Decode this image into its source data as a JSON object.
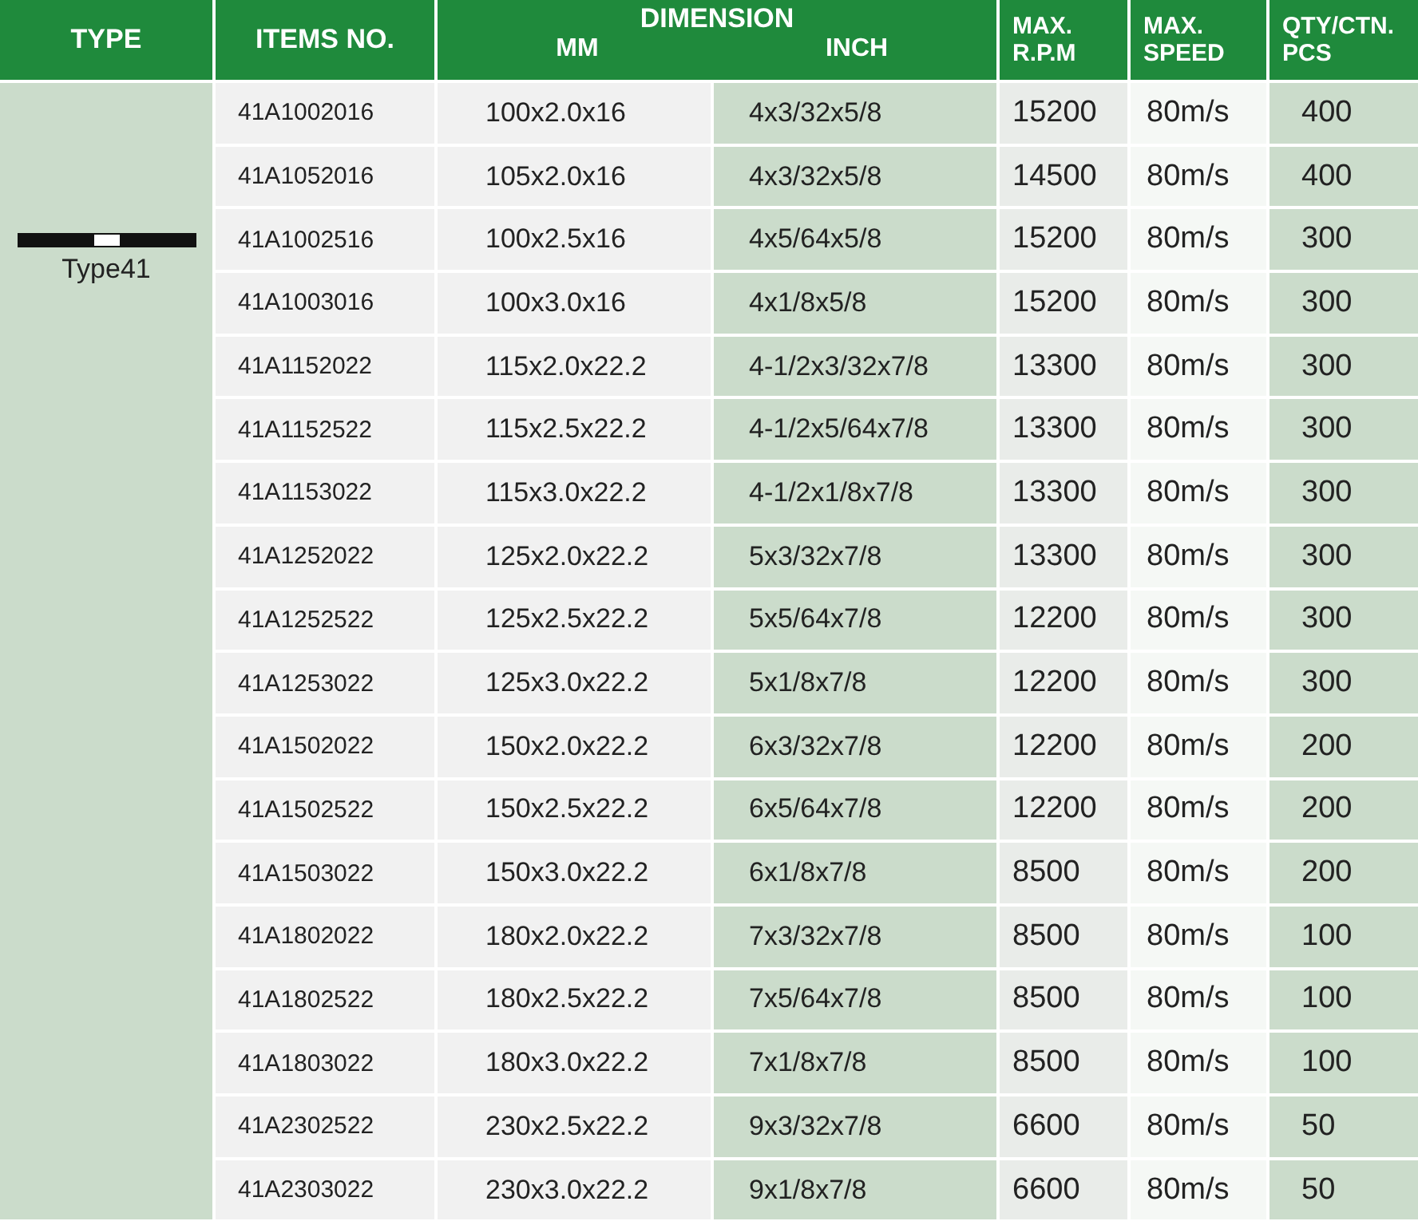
{
  "header": {
    "type": "TYPE",
    "items_no": "ITEMS NO.",
    "dimension": "DIMENSION",
    "mm": "MM",
    "inch": "INCH",
    "max_rpm": [
      "MAX.",
      "R.P.M"
    ],
    "max_speed": [
      "MAX.",
      "SPEED"
    ],
    "qty": [
      "QTY/CTN.",
      "PCS"
    ]
  },
  "type_cell": {
    "label": "Type41"
  },
  "rows": [
    {
      "item": "41A1002016",
      "mm": "100x2.0x16",
      "inch": "4x3/32x5/8",
      "rpm": "15200",
      "speed": "80m/s",
      "qty": "400"
    },
    {
      "item": "41A1052016",
      "mm": "105x2.0x16",
      "inch": "4x3/32x5/8",
      "rpm": "14500",
      "speed": "80m/s",
      "qty": "400"
    },
    {
      "item": "41A1002516",
      "mm": "100x2.5x16",
      "inch": "4x5/64x5/8",
      "rpm": "15200",
      "speed": "80m/s",
      "qty": "300"
    },
    {
      "item": "41A1003016",
      "mm": "100x3.0x16",
      "inch": "4x1/8x5/8",
      "rpm": "15200",
      "speed": "80m/s",
      "qty": "300"
    },
    {
      "item": "41A1152022",
      "mm": "115x2.0x22.2",
      "inch": "4-1/2x3/32x7/8",
      "rpm": "13300",
      "speed": "80m/s",
      "qty": "300"
    },
    {
      "item": "41A1152522",
      "mm": "115x2.5x22.2",
      "inch": "4-1/2x5/64x7/8",
      "rpm": "13300",
      "speed": "80m/s",
      "qty": "300"
    },
    {
      "item": "41A1153022",
      "mm": "115x3.0x22.2",
      "inch": "4-1/2x1/8x7/8",
      "rpm": "13300",
      "speed": "80m/s",
      "qty": "300"
    },
    {
      "item": "41A1252022",
      "mm": "125x2.0x22.2",
      "inch": "5x3/32x7/8",
      "rpm": "13300",
      "speed": "80m/s",
      "qty": "300"
    },
    {
      "item": "41A1252522",
      "mm": "125x2.5x22.2",
      "inch": "5x5/64x7/8",
      "rpm": "12200",
      "speed": "80m/s",
      "qty": "300"
    },
    {
      "item": "41A1253022",
      "mm": "125x3.0x22.2",
      "inch": "5x1/8x7/8",
      "rpm": "12200",
      "speed": "80m/s",
      "qty": "300"
    },
    {
      "item": "41A1502022",
      "mm": "150x2.0x22.2",
      "inch": "6x3/32x7/8",
      "rpm": "12200",
      "speed": "80m/s",
      "qty": "200"
    },
    {
      "item": "41A1502522",
      "mm": "150x2.5x22.2",
      "inch": "6x5/64x7/8",
      "rpm": "12200",
      "speed": "80m/s",
      "qty": "200"
    },
    {
      "item": "41A1503022",
      "mm": "150x3.0x22.2",
      "inch": "6x1/8x7/8",
      "rpm": "8500",
      "speed": "80m/s",
      "qty": "200"
    },
    {
      "item": "41A1802022",
      "mm": "180x2.0x22.2",
      "inch": "7x3/32x7/8",
      "rpm": "8500",
      "speed": "80m/s",
      "qty": "100"
    },
    {
      "item": "41A1802522",
      "mm": "180x2.5x22.2",
      "inch": "7x5/64x7/8",
      "rpm": "8500",
      "speed": "80m/s",
      "qty": "100"
    },
    {
      "item": "41A1803022",
      "mm": "180x3.0x22.2",
      "inch": "7x1/8x7/8",
      "rpm": "8500",
      "speed": "80m/s",
      "qty": "100"
    },
    {
      "item": "41A2302522",
      "mm": "230x2.5x22.2",
      "inch": "9x3/32x7/8",
      "rpm": "6600",
      "speed": "80m/s",
      "qty": "50"
    },
    {
      "item": "41A2303022",
      "mm": "230x3.0x22.2",
      "inch": "9x1/8x7/8",
      "rpm": "6600",
      "speed": "80m/s",
      "qty": "50"
    }
  ]
}
